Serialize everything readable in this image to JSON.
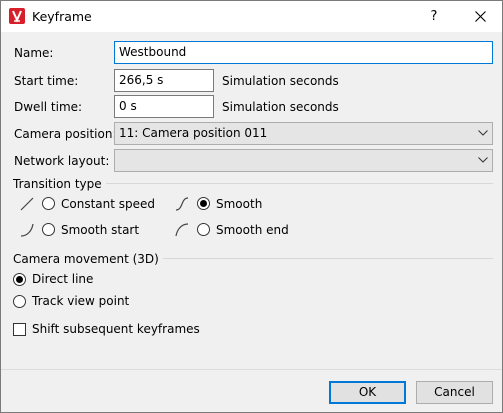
{
  "window": {
    "title": "Keyframe",
    "help_glyph": "?",
    "app_icon": "vissim-logo-icon",
    "accent_color": "#0078d7",
    "brand_color": "#d61f2a"
  },
  "form": {
    "name": {
      "label": "Name:",
      "value": "Westbound"
    },
    "start_time": {
      "label": "Start time:",
      "value": "266,5 s",
      "unit": "Simulation seconds"
    },
    "dwell_time": {
      "label": "Dwell time:",
      "value": "0 s",
      "unit": "Simulation seconds"
    },
    "camera_position": {
      "label": "Camera position:",
      "value": "11: Camera position 011"
    },
    "network_layout": {
      "label": "Network layout:",
      "value": ""
    }
  },
  "transition": {
    "group_label": "Transition type",
    "options": [
      {
        "label": "Constant speed",
        "checked": false,
        "icon": "linear-curve-icon"
      },
      {
        "label": "Smooth",
        "checked": true,
        "icon": "ease-in-out-curve-icon"
      },
      {
        "label": "Smooth start",
        "checked": false,
        "icon": "ease-in-curve-icon"
      },
      {
        "label": "Smooth end",
        "checked": false,
        "icon": "ease-out-curve-icon"
      }
    ]
  },
  "camera_movement": {
    "group_label": "Camera movement (3D)",
    "options": [
      {
        "label": "Direct line",
        "checked": true
      },
      {
        "label": "Track view point",
        "checked": false
      }
    ]
  },
  "shift_keyframes": {
    "label": "Shift subsequent keyframes",
    "checked": false
  },
  "buttons": {
    "ok": "OK",
    "cancel": "Cancel"
  }
}
